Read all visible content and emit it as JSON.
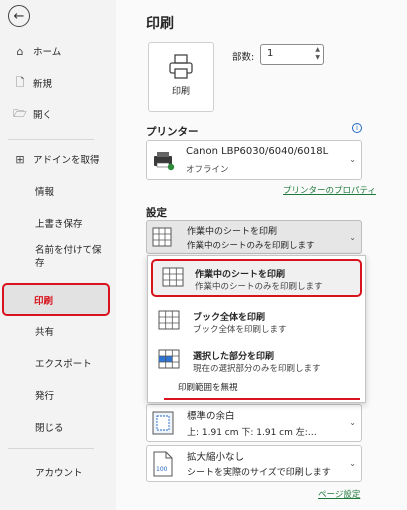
{
  "sidebar": {
    "items": [
      {
        "label": "ホーム",
        "icon": "home-icon"
      },
      {
        "label": "新規",
        "icon": "new-document-icon"
      },
      {
        "label": "開く",
        "icon": "folder-open-icon"
      },
      {
        "label": "アドインを取得",
        "icon": "addin-grid-icon"
      },
      {
        "label": "情報"
      },
      {
        "label": "上書き保存"
      },
      {
        "label": "名前を付けて保存"
      },
      {
        "label": "印刷"
      },
      {
        "label": "共有"
      },
      {
        "label": "エクスポート"
      },
      {
        "label": "発行"
      },
      {
        "label": "閉じる"
      },
      {
        "label": "アカウント"
      }
    ],
    "active": "印刷"
  },
  "main": {
    "title": "印刷",
    "print_button_label": "印刷",
    "copies_label": "部数:",
    "copies_value": "1",
    "printer_section": "プリンター",
    "printer_name": "Canon LBP6030/6040/6018L",
    "printer_status": "オフライン",
    "printer_properties_link": "プリンターのプロパティ",
    "settings_section": "設定",
    "print_what": {
      "title": "作業中のシートを印刷",
      "subtitle": "作業中のシートのみを印刷します"
    },
    "popup_options": [
      {
        "title": "作業中のシートを印刷",
        "subtitle": "作業中のシートのみを印刷します",
        "selected": true
      },
      {
        "title": "ブック全体を印刷",
        "subtitle": "ブック全体を印刷します",
        "selected": false
      },
      {
        "title": "選択した部分を印刷",
        "subtitle": "現在の選択部分のみを印刷します",
        "selected": false
      }
    ],
    "ignore_print_area": "印刷範囲を無視",
    "margins": {
      "title": "標準の余白",
      "subtitle": "上: 1.91 cm 下: 1.91 cm 左:…"
    },
    "scaling": {
      "title": "拡大縮小なし",
      "subtitle": "シートを実際のサイズで印刷します",
      "icon_text": "100"
    },
    "page_setup_link": "ページ設定"
  },
  "colors": {
    "highlight_red": "#d8131e",
    "link_green": "#1e7a3c",
    "info_blue": "#2468c6"
  }
}
